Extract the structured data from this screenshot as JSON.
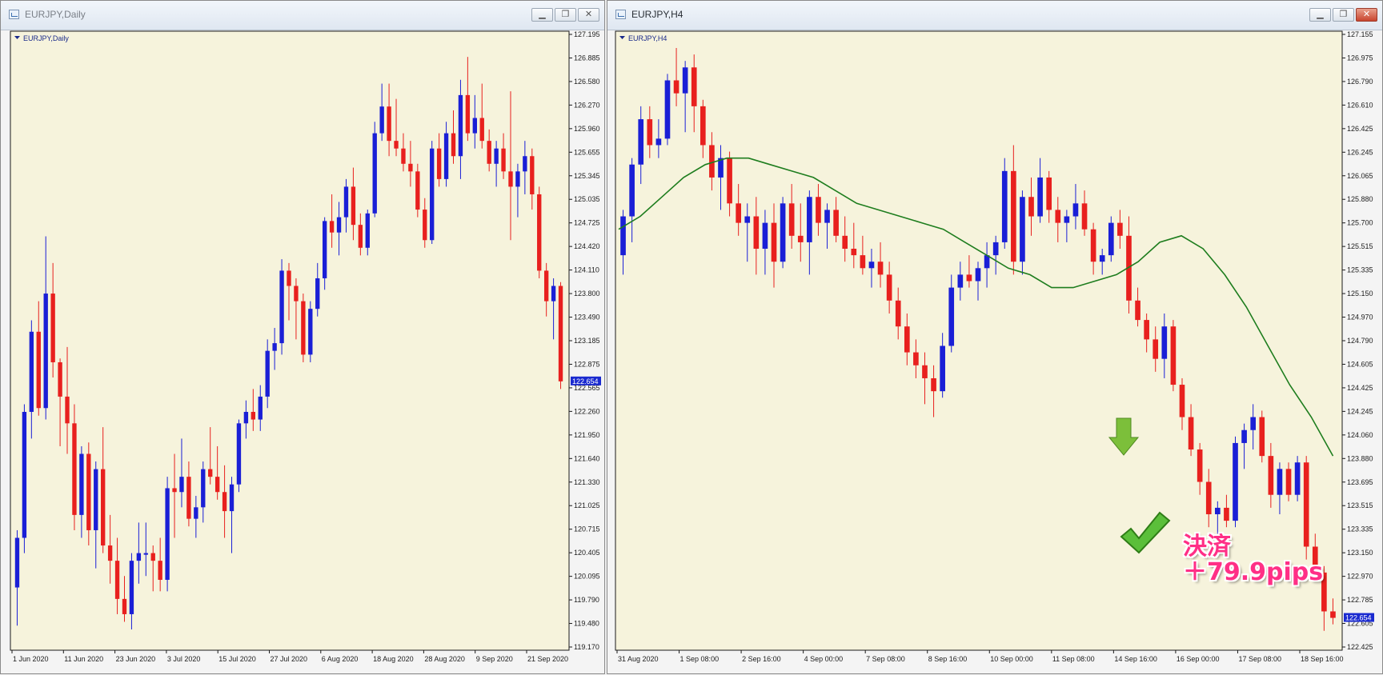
{
  "left": {
    "title": "EURJPY,Daily",
    "chart_label": "EURJPY,Daily",
    "price_marker": "122.654",
    "y_ticks": [
      "127.195",
      "126.885",
      "126.580",
      "126.270",
      "125.960",
      "125.655",
      "125.345",
      "125.035",
      "124.725",
      "124.420",
      "124.110",
      "123.800",
      "123.490",
      "123.185",
      "122.875",
      "122.565",
      "122.260",
      "121.950",
      "121.640",
      "121.330",
      "121.025",
      "120.715",
      "120.405",
      "120.095",
      "119.790",
      "119.480",
      "119.170"
    ],
    "x_ticks": [
      "1 Jun 2020",
      "11 Jun 2020",
      "23 Jun 2020",
      "3 Jul 2020",
      "15 Jul 2020",
      "27 Jul 2020",
      "6 Aug 2020",
      "18 Aug 2020",
      "28 Aug 2020",
      "9 Sep 2020",
      "21 Sep 2020"
    ]
  },
  "right": {
    "title": "EURJPY,H4",
    "chart_label": "EURJPY,H4",
    "price_marker": "122.654",
    "y_ticks": [
      "127.155",
      "126.975",
      "126.790",
      "126.610",
      "126.425",
      "126.245",
      "126.065",
      "125.880",
      "125.700",
      "125.515",
      "125.335",
      "125.150",
      "124.970",
      "124.790",
      "124.605",
      "124.425",
      "124.245",
      "124.060",
      "123.880",
      "123.695",
      "123.515",
      "123.335",
      "123.150",
      "122.970",
      "122.785",
      "122.605",
      "122.425"
    ],
    "x_ticks": [
      "31 Aug 2020",
      "1 Sep 08:00",
      "2 Sep 16:00",
      "4 Sep 00:00",
      "7 Sep 08:00",
      "8 Sep 16:00",
      "10 Sep 00:00",
      "11 Sep 08:00",
      "14 Sep 16:00",
      "16 Sep 00:00",
      "17 Sep 08:00",
      "18 Sep 16:00"
    ]
  },
  "annotation": {
    "close_label": "決済",
    "profit_label": "＋79.9pips"
  },
  "colors": {
    "background": "#f6f3dc",
    "bull": "#1a1fd6",
    "bear": "#e8201e",
    "ma": "#1e7d1e",
    "axis_text": "#1a2a8a",
    "marker_bg": "#1a2ad0",
    "arrow": "#7cbf3a"
  },
  "icons": [
    "chart-window-icon",
    "minimize-icon",
    "restore-icon",
    "close-icon",
    "down-arrow-icon",
    "checkmark-icon"
  ],
  "chart_data": [
    {
      "type": "candlestick",
      "title": "EURJPY,Daily",
      "ylim": [
        119.17,
        127.195
      ],
      "dates": [
        "1 Jun 2020",
        "11 Jun 2020",
        "23 Jun 2020",
        "3 Jul 2020",
        "15 Jul 2020",
        "27 Jul 2020",
        "6 Aug 2020",
        "18 Aug 2020",
        "28 Aug 2020",
        "9 Sep 2020",
        "21 Sep 2020"
      ],
      "candles": [
        [
          119.95,
          120.7,
          119.45,
          120.6
        ],
        [
          120.6,
          122.35,
          120.4,
          122.25
        ],
        [
          122.25,
          123.45,
          121.9,
          123.3
        ],
        [
          123.3,
          123.7,
          122.2,
          122.3
        ],
        [
          122.3,
          124.55,
          122.15,
          123.8
        ],
        [
          123.8,
          124.2,
          122.7,
          122.9
        ],
        [
          122.9,
          122.95,
          121.8,
          122.45
        ],
        [
          122.45,
          123.1,
          121.7,
          122.1
        ],
        [
          122.1,
          122.35,
          120.7,
          120.9
        ],
        [
          120.9,
          121.8,
          120.6,
          121.7
        ],
        [
          121.7,
          121.85,
          120.5,
          120.7
        ],
        [
          120.7,
          121.6,
          120.2,
          121.5
        ],
        [
          121.5,
          122.05,
          120.4,
          120.5
        ],
        [
          120.5,
          120.9,
          120.0,
          120.3
        ],
        [
          120.3,
          120.6,
          119.6,
          119.8
        ],
        [
          119.8,
          120.1,
          119.5,
          119.6
        ],
        [
          119.6,
          120.4,
          119.4,
          120.3
        ],
        [
          120.3,
          120.8,
          120.0,
          120.4
        ],
        [
          120.4,
          120.8,
          120.1,
          120.4
        ],
        [
          120.4,
          120.5,
          119.9,
          120.3
        ],
        [
          120.3,
          120.6,
          119.9,
          120.05
        ],
        [
          120.05,
          121.4,
          119.9,
          121.25
        ],
        [
          121.25,
          121.7,
          120.6,
          121.2
        ],
        [
          121.2,
          121.9,
          121.0,
          121.4
        ],
        [
          121.4,
          121.6,
          120.75,
          120.85
        ],
        [
          120.85,
          121.15,
          120.6,
          121.0
        ],
        [
          121.0,
          121.6,
          120.8,
          121.5
        ],
        [
          121.5,
          122.05,
          121.3,
          121.4
        ],
        [
          121.4,
          121.8,
          121.1,
          121.2
        ],
        [
          121.2,
          121.55,
          120.6,
          120.95
        ],
        [
          120.95,
          121.4,
          120.4,
          121.3
        ],
        [
          121.3,
          122.15,
          121.2,
          122.1
        ],
        [
          122.1,
          122.4,
          121.9,
          122.25
        ],
        [
          122.25,
          122.55,
          122.0,
          122.15
        ],
        [
          122.15,
          122.6,
          122.0,
          122.45
        ],
        [
          122.45,
          123.2,
          122.3,
          123.05
        ],
        [
          123.05,
          123.35,
          122.8,
          123.15
        ],
        [
          123.15,
          124.25,
          123.0,
          124.1
        ],
        [
          124.1,
          124.2,
          123.45,
          123.9
        ],
        [
          123.9,
          124.0,
          123.2,
          123.7
        ],
        [
          123.7,
          123.8,
          122.9,
          123.0
        ],
        [
          123.0,
          123.7,
          122.9,
          123.6
        ],
        [
          123.6,
          124.2,
          123.5,
          124.0
        ],
        [
          124.0,
          124.8,
          123.85,
          124.75
        ],
        [
          124.75,
          125.1,
          124.4,
          124.6
        ],
        [
          124.6,
          125.0,
          124.3,
          124.8
        ],
        [
          124.8,
          125.3,
          124.6,
          125.2
        ],
        [
          125.2,
          125.45,
          124.5,
          124.7
        ],
        [
          124.7,
          124.85,
          124.3,
          124.4
        ],
        [
          124.4,
          124.9,
          124.3,
          124.85
        ],
        [
          124.85,
          126.05,
          124.8,
          125.9
        ],
        [
          125.9,
          126.55,
          125.8,
          126.25
        ],
        [
          126.25,
          126.55,
          125.6,
          125.8
        ],
        [
          125.8,
          126.35,
          125.6,
          125.7
        ],
        [
          125.7,
          125.9,
          125.4,
          125.5
        ],
        [
          125.5,
          125.8,
          125.2,
          125.4
        ],
        [
          125.4,
          125.5,
          124.8,
          124.9
        ],
        [
          124.9,
          125.05,
          124.4,
          124.5
        ],
        [
          124.5,
          125.8,
          124.45,
          125.7
        ],
        [
          125.7,
          125.9,
          125.2,
          125.3
        ],
        [
          125.3,
          126.05,
          125.2,
          125.9
        ],
        [
          125.9,
          126.2,
          125.5,
          125.6
        ],
        [
          125.6,
          126.6,
          125.3,
          126.4
        ],
        [
          126.4,
          126.9,
          125.8,
          125.9
        ],
        [
          125.9,
          126.4,
          125.7,
          126.1
        ],
        [
          126.1,
          126.55,
          125.7,
          125.8
        ],
        [
          125.8,
          125.95,
          125.4,
          125.5
        ],
        [
          125.5,
          125.8,
          125.2,
          125.7
        ],
        [
          125.7,
          125.9,
          125.3,
          125.4
        ],
        [
          125.4,
          126.45,
          124.5,
          125.2
        ],
        [
          125.2,
          125.5,
          124.8,
          125.4
        ],
        [
          125.4,
          125.8,
          125.1,
          125.6
        ],
        [
          125.6,
          125.7,
          124.9,
          125.1
        ],
        [
          125.1,
          125.2,
          124.0,
          124.1
        ],
        [
          124.1,
          124.2,
          123.5,
          123.7
        ],
        [
          123.7,
          124.0,
          123.2,
          123.9
        ],
        [
          123.9,
          123.95,
          122.55,
          122.65
        ]
      ]
    },
    {
      "type": "candlestick",
      "title": "EURJPY,H4",
      "ylim": [
        122.425,
        127.155
      ],
      "dates": [
        "31 Aug 2020",
        "1 Sep 08:00",
        "2 Sep 16:00",
        "4 Sep 00:00",
        "7 Sep 08:00",
        "8 Sep 16:00",
        "10 Sep 00:00",
        "11 Sep 08:00",
        "14 Sep 16:00",
        "16 Sep 00:00",
        "17 Sep 08:00",
        "18 Sep 16:00"
      ],
      "candles": [
        [
          125.45,
          125.8,
          125.3,
          125.75
        ],
        [
          125.75,
          126.2,
          125.55,
          126.15
        ],
        [
          126.15,
          126.6,
          126.0,
          126.5
        ],
        [
          126.5,
          126.6,
          126.2,
          126.3
        ],
        [
          126.3,
          126.5,
          126.2,
          126.35
        ],
        [
          126.35,
          126.85,
          126.3,
          126.8
        ],
        [
          126.8,
          127.05,
          126.6,
          126.7
        ],
        [
          126.7,
          126.95,
          126.4,
          126.9
        ],
        [
          126.9,
          127.0,
          126.4,
          126.6
        ],
        [
          126.6,
          126.65,
          126.2,
          126.3
        ],
        [
          126.3,
          126.4,
          125.95,
          126.05
        ],
        [
          126.05,
          126.3,
          125.8,
          126.2
        ],
        [
          126.2,
          126.25,
          125.75,
          125.85
        ],
        [
          125.85,
          126.0,
          125.6,
          125.7
        ],
        [
          125.7,
          125.85,
          125.4,
          125.75
        ],
        [
          125.75,
          125.9,
          125.3,
          125.5
        ],
        [
          125.5,
          125.8,
          125.3,
          125.7
        ],
        [
          125.7,
          125.85,
          125.2,
          125.4
        ],
        [
          125.4,
          125.9,
          125.35,
          125.85
        ],
        [
          125.85,
          126.0,
          125.5,
          125.6
        ],
        [
          125.6,
          125.85,
          125.4,
          125.55
        ],
        [
          125.55,
          125.95,
          125.3,
          125.9
        ],
        [
          125.9,
          126.0,
          125.6,
          125.7
        ],
        [
          125.7,
          125.85,
          125.5,
          125.8
        ],
        [
          125.8,
          125.9,
          125.55,
          125.6
        ],
        [
          125.6,
          125.75,
          125.4,
          125.5
        ],
        [
          125.5,
          125.7,
          125.35,
          125.45
        ],
        [
          125.45,
          125.6,
          125.3,
          125.35
        ],
        [
          125.35,
          125.5,
          125.2,
          125.4
        ],
        [
          125.4,
          125.55,
          125.2,
          125.3
        ],
        [
          125.3,
          125.4,
          125.0,
          125.1
        ],
        [
          125.1,
          125.2,
          124.8,
          124.9
        ],
        [
          124.9,
          125.0,
          124.6,
          124.7
        ],
        [
          124.7,
          124.8,
          124.5,
          124.6
        ],
        [
          124.6,
          124.7,
          124.3,
          124.5
        ],
        [
          124.5,
          124.6,
          124.2,
          124.4
        ],
        [
          124.4,
          124.85,
          124.35,
          124.75
        ],
        [
          124.75,
          125.3,
          124.7,
          125.2
        ],
        [
          125.2,
          125.4,
          125.1,
          125.3
        ],
        [
          125.3,
          125.45,
          125.2,
          125.25
        ],
        [
          125.25,
          125.4,
          125.1,
          125.35
        ],
        [
          125.35,
          125.55,
          125.2,
          125.45
        ],
        [
          125.45,
          125.6,
          125.3,
          125.55
        ],
        [
          125.55,
          126.2,
          125.5,
          126.1
        ],
        [
          126.1,
          126.3,
          125.3,
          125.4
        ],
        [
          125.4,
          125.95,
          125.3,
          125.9
        ],
        [
          125.9,
          126.05,
          125.6,
          125.75
        ],
        [
          125.75,
          126.2,
          125.7,
          126.05
        ],
        [
          126.05,
          126.1,
          125.7,
          125.8
        ],
        [
          125.8,
          125.9,
          125.55,
          125.7
        ],
        [
          125.7,
          125.8,
          125.55,
          125.75
        ],
        [
          125.75,
          126.0,
          125.65,
          125.85
        ],
        [
          125.85,
          125.95,
          125.6,
          125.65
        ],
        [
          125.65,
          125.7,
          125.3,
          125.4
        ],
        [
          125.4,
          125.5,
          125.3,
          125.45
        ],
        [
          125.45,
          125.75,
          125.4,
          125.7
        ],
        [
          125.7,
          125.8,
          125.5,
          125.6
        ],
        [
          125.6,
          125.75,
          125.0,
          125.1
        ],
        [
          125.1,
          125.2,
          124.9,
          124.95
        ],
        [
          124.95,
          125.0,
          124.7,
          124.8
        ],
        [
          124.8,
          124.9,
          124.55,
          124.65
        ],
        [
          124.65,
          125.0,
          124.5,
          124.9
        ],
        [
          124.9,
          124.95,
          124.4,
          124.45
        ],
        [
          124.45,
          124.5,
          124.1,
          124.2
        ],
        [
          124.2,
          124.3,
          123.9,
          123.95
        ],
        [
          123.95,
          124.0,
          123.6,
          123.7
        ],
        [
          123.7,
          123.8,
          123.35,
          123.45
        ],
        [
          123.45,
          123.55,
          123.3,
          123.5
        ],
        [
          123.5,
          123.6,
          123.35,
          123.4
        ],
        [
          123.4,
          124.05,
          123.35,
          124.0
        ],
        [
          124.0,
          124.15,
          123.8,
          124.1
        ],
        [
          124.1,
          124.3,
          123.95,
          124.2
        ],
        [
          124.2,
          124.25,
          123.85,
          123.9
        ],
        [
          123.9,
          124.0,
          123.5,
          123.6
        ],
        [
          123.6,
          123.85,
          123.45,
          123.8
        ],
        [
          123.8,
          123.85,
          123.55,
          123.6
        ],
        [
          123.6,
          123.9,
          123.55,
          123.85
        ],
        [
          123.85,
          123.9,
          123.1,
          123.2
        ],
        [
          123.2,
          123.3,
          122.95,
          123.0
        ],
        [
          123.0,
          123.05,
          122.55,
          122.7
        ],
        [
          122.7,
          122.8,
          122.6,
          122.65
        ]
      ],
      "series": [
        {
          "name": "moving average",
          "values": [
            125.65,
            125.75,
            125.9,
            126.05,
            126.15,
            126.2,
            126.2,
            126.15,
            126.1,
            126.05,
            125.95,
            125.85,
            125.8,
            125.75,
            125.7,
            125.65,
            125.55,
            125.45,
            125.35,
            125.3,
            125.2,
            125.2,
            125.25,
            125.3,
            125.4,
            125.55,
            125.6,
            125.5,
            125.3,
            125.05,
            124.75,
            124.45,
            124.2,
            123.9
          ]
        }
      ]
    }
  ]
}
